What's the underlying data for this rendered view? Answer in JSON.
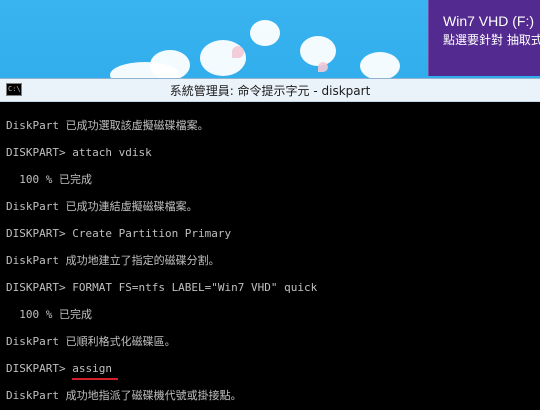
{
  "notification": {
    "title": "Win7 VHD (F:)",
    "body": "點選要針對 抽取式"
  },
  "window": {
    "icon_text": "C:\\",
    "title": "系統管理員: 命令提示字元 - diskpart"
  },
  "console": {
    "lines": [
      "DiskPart 已成功選取該虛擬磁碟檔案。",
      "DISKPART> attach vdisk",
      "  100 % 已完成",
      "DiskPart 已成功連結虛擬磁碟檔案。",
      "DISKPART> Create Partition Primary",
      "DiskPart 成功地建立了指定的磁碟分割。",
      "DISKPART> FORMAT FS=ntfs LABEL=\"Win7 VHD\" quick",
      "  100 % 已完成",
      "DiskPart 已順利格式化磁碟區。",
      "DISKPART> assign",
      "DiskPart 成功地指派了磁碟機代號或掛接點。"
    ],
    "highlighted_command": "assign",
    "highlight_color": "#d21f2a",
    "text_color": "#c0c0c0",
    "background_color": "#000000"
  }
}
